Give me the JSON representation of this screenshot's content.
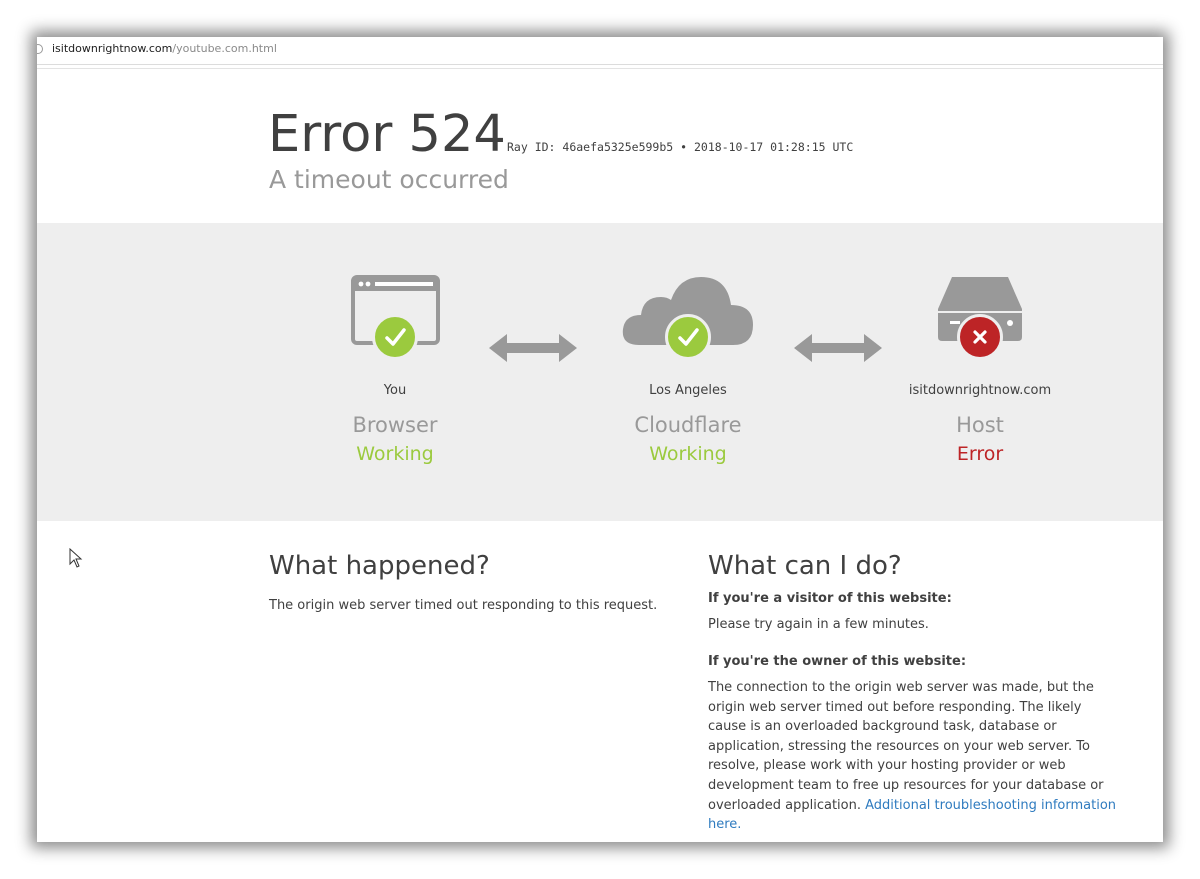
{
  "browser": {
    "url_host": "isitdownrightnow.com",
    "url_path": "/youtube.com.html"
  },
  "header": {
    "error_code": "Error 524",
    "ray_label": "Ray ID:",
    "ray_id": "46aefa5325e599b5",
    "bullet": "•",
    "timestamp": "2018-10-17 01:28:15 UTC",
    "subtitle": "A timeout occurred"
  },
  "nodes": [
    {
      "location": "You",
      "kind": "Browser",
      "status": "Working",
      "icon": "browser-icon",
      "badge": "checkmark"
    },
    {
      "location": "Los Angeles",
      "kind": "Cloudflare",
      "status": "Working",
      "icon": "cloud-icon",
      "badge": "checkmark"
    },
    {
      "location": "isitdownrightnow.com",
      "kind": "Host",
      "status": "Error",
      "icon": "server-icon",
      "badge": "cross"
    }
  ],
  "what_happened": {
    "heading": "What happened?",
    "body": "The origin web server timed out responding to this request."
  },
  "what_can_i_do": {
    "heading": "What can I do?",
    "visitor_heading": "If you're a visitor of this website:",
    "visitor_body": "Please try again in a few minutes.",
    "owner_heading": "If you're the owner of this website:",
    "owner_body": "The connection to the origin web server was made, but the origin web server timed out before responding. The likely cause is an overloaded background task, database or application, stressing the resources on your web server. To resolve, please work with your hosting provider or web development team to free up resources for your database or overloaded application.",
    "link_text": "Additional troubleshooting information here."
  },
  "colors": {
    "working": "#9bca3e",
    "error": "#bd2426",
    "icon_gray": "#999999",
    "band": "#eeeeee",
    "link": "#2f7bbf"
  }
}
